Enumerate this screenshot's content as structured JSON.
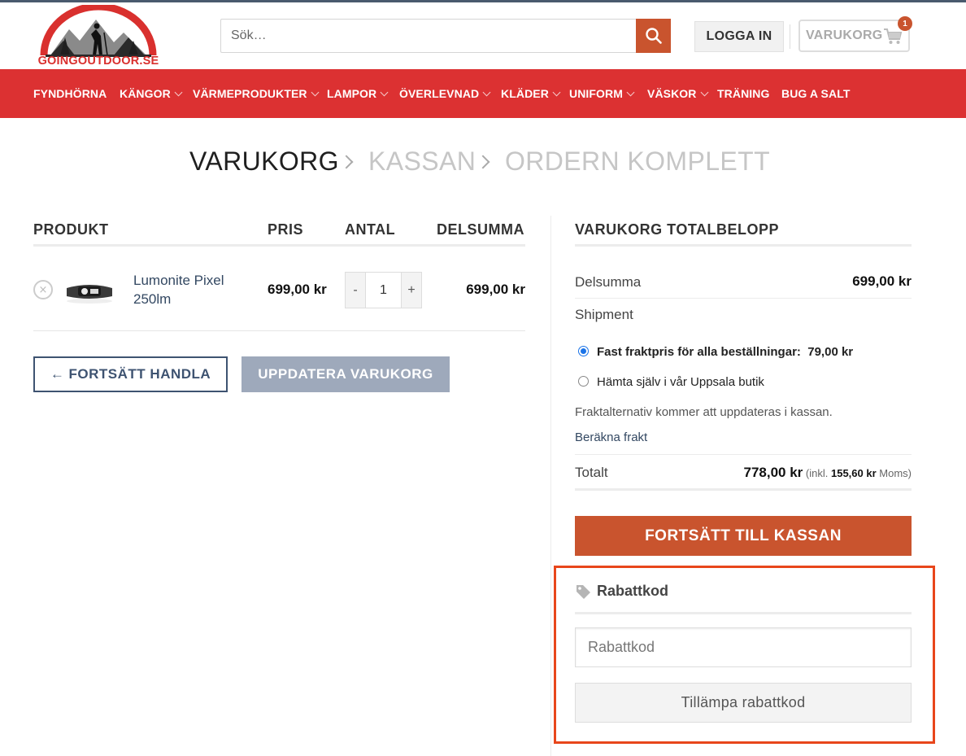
{
  "header": {
    "logo_text": "GOINGOUTDOOR.SE",
    "search_placeholder": "Sök…",
    "login_label": "LOGGA IN",
    "cart_label": "VARUKORG",
    "cart_count": "1"
  },
  "nav": {
    "items": [
      {
        "label": "FYNDHÖRNA"
      },
      {
        "label": "KÄNGOR"
      },
      {
        "label": "VÄRMEPRODUKTER"
      },
      {
        "label": "LAMPOR"
      },
      {
        "label": "ÖVERLEVNAD"
      },
      {
        "label": "KLÄDER"
      },
      {
        "label": "UNIFORM"
      },
      {
        "label": "VÄSKOR"
      },
      {
        "label": "TRÄNING"
      },
      {
        "label": "BUG A SALT"
      }
    ]
  },
  "breadcrumb": {
    "steps": [
      "VARUKORG",
      "KASSAN",
      "ORDERN KOMPLETT"
    ]
  },
  "cart_table": {
    "headers": [
      "PRODUKT",
      "PRIS",
      "ANTAL",
      "DELSUMMA"
    ],
    "rows": [
      {
        "remove": "×",
        "name": "Lumonite Pixel 250lm",
        "price": "699,00 kr",
        "qty": "1",
        "subtotal": "699,00 kr"
      }
    ],
    "qty_minus": "-",
    "qty_plus": "+",
    "continue_label": "← FORTSÄTT HANDLA",
    "update_label": "UPPDATERA VARUKORG"
  },
  "totals": {
    "title": "VARUKORG TOTALBELOPP",
    "subtotal_label": "Delsumma",
    "subtotal_value": "699,00 kr",
    "shipment_label": "Shipment",
    "shipping_options": [
      {
        "label": "Fast fraktpris för alla beställningar:",
        "price": "79,00 kr",
        "checked": true
      },
      {
        "label": "Hämta själv i vår Uppsala butik",
        "price": "",
        "checked": false
      }
    ],
    "shipping_note": "Fraktalternativ kommer att uppdateras i kassan.",
    "calc_link": "Beräkna frakt",
    "total_label": "Totalt",
    "total_value": "778,00 kr",
    "tax_prefix": "(inkl.",
    "tax_value": "155,60 kr",
    "tax_suffix": "Moms)",
    "checkout_label": "FORTSÄTT TILL KASSAN"
  },
  "coupon": {
    "title": "Rabattkod",
    "input_placeholder": "Rabattkod",
    "apply_label": "Tillämpa rabattkod"
  },
  "colors": {
    "nav_bg": "#dc3132",
    "accent": "#c9542e",
    "link": "#334862",
    "highlight_border": "#e8461b"
  }
}
